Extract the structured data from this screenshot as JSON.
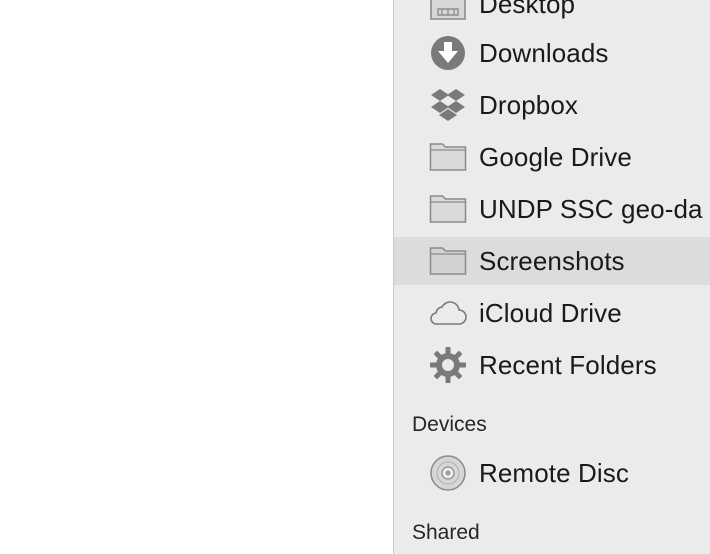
{
  "sidebar": {
    "favorites": [
      {
        "label": "Desktop",
        "icon": "desktop-folder-icon"
      },
      {
        "label": "Downloads",
        "icon": "downloads-icon"
      },
      {
        "label": "Dropbox",
        "icon": "dropbox-icon"
      },
      {
        "label": "Google Drive",
        "icon": "folder-icon"
      },
      {
        "label": "UNDP SSC geo-da",
        "icon": "folder-icon"
      },
      {
        "label": "Screenshots",
        "icon": "folder-icon",
        "selected": true
      },
      {
        "label": "iCloud Drive",
        "icon": "icloud-icon"
      },
      {
        "label": "Recent Folders",
        "icon": "gear-icon"
      }
    ],
    "devices_header": "Devices",
    "devices": [
      {
        "label": "Remote Disc",
        "icon": "disc-icon"
      }
    ],
    "shared_header": "Shared"
  },
  "colors": {
    "sidebar_bg": "#ebebeb",
    "selection_bg": "#dcdcdc",
    "icon_gray": "#7a7a7a"
  }
}
